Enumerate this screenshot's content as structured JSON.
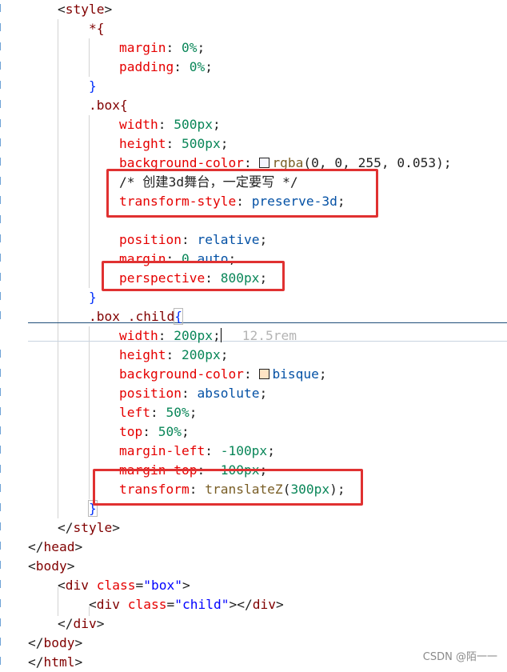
{
  "code": {
    "style_open": "<style>",
    "l_star": "*{",
    "l_margin_prop": "margin",
    "l_margin_val": "0%",
    "l_padding_prop": "padding",
    "l_padding_val": "0%",
    "close_brace": "}",
    "l_box_sel": ".box{",
    "l_width_prop": "width",
    "l_width_val": "500px",
    "l_height_prop": "height",
    "l_height_val": "500px",
    "l_bg_prop": "background-color",
    "l_bg_fn": "rgba",
    "l_bg_args": "(0, 0, 255, 0.053)",
    "l_comment": "/* 创建3d舞台，一定要写 */",
    "l_ts_prop": "transform-style",
    "l_ts_val": "preserve-3d",
    "l_pos_prop": "position",
    "l_pos_val": "relative",
    "l_margin2_prop": "margin",
    "l_margin2_num": "0",
    "l_margin2_kw": "auto",
    "l_persp_prop": "perspective",
    "l_persp_val": "800px",
    "l_child_sel": ".box .child",
    "l_child_open": "{",
    "c_width_prop": "width",
    "c_width_val": "200px",
    "c_width_hint": "12.5rem",
    "c_height_prop": "height",
    "c_height_val": "200px",
    "c_bg_prop": "background-color",
    "c_bg_val": "bisque",
    "c_pos_prop": "position",
    "c_pos_val": "absolute",
    "c_left_prop": "left",
    "c_left_val": "50%",
    "c_top_prop": "top",
    "c_top_val": "50%",
    "c_ml_prop": "margin-left",
    "c_ml_val": "-100px",
    "c_mt_prop": "margin-top",
    "c_mt_val": "-100px",
    "c_tf_prop": "transform",
    "c_tf_fn": "translateZ",
    "c_tf_val": "300px",
    "style_close": "</style>",
    "head_close": "</head>",
    "body_open": "<body>",
    "div_box_open_a": "<div ",
    "div_box_attr": "class",
    "div_box_attrval": "\"box\"",
    "div_child_attrval": "\"child\"",
    "div_child_close": "></div>",
    "div_close": "</div>",
    "body_close": "</body>",
    "html_close": "</html>"
  },
  "colors": {
    "highlight_box": "#e03131",
    "rgba_swatch": "#f4f4ff",
    "bisque_swatch": "#ffe4c4"
  },
  "watermark": "CSDN @陌一一"
}
